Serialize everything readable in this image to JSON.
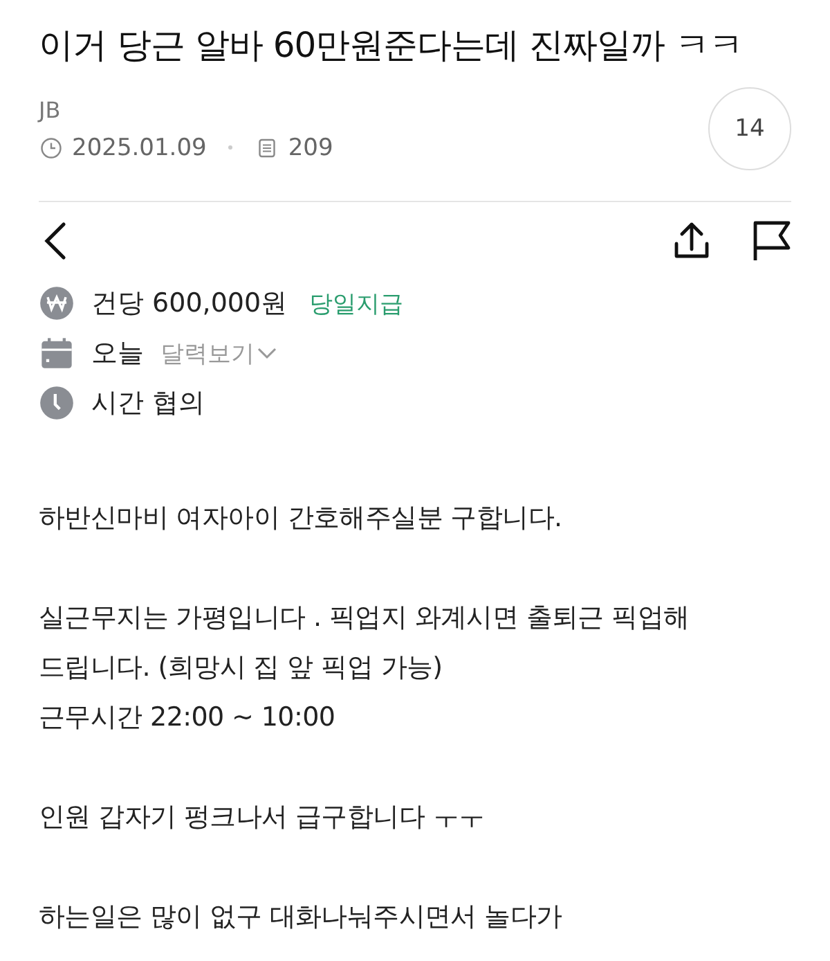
{
  "post": {
    "title": "이거 당근 알바 60만원준다는데 진짜일까 ㅋㅋ",
    "author": "JB",
    "date": "2025.01.09",
    "views": "209",
    "comments": "14"
  },
  "job": {
    "pay": "건당 600,000원",
    "pay_tag": "당일지급",
    "day": "오늘",
    "calendar_link": "달력보기",
    "time": "시간 협의"
  },
  "body": [
    [
      "하반신마비 여자아이 간호해주실분 구합니다."
    ],
    [
      "실근무지는 가평입니다 . 픽업지 와계시면 출퇴근 픽업해",
      "드립니다. (희망시 집 앞 픽업 가능)",
      "근무시간 22:00 ~ 10:00"
    ],
    [
      "인원 갑자기 펑크나서 급구합니다 ㅜㅜ"
    ],
    [
      "하는일은 많이 없구 대화나눠주시면서 놀다가"
    ]
  ]
}
